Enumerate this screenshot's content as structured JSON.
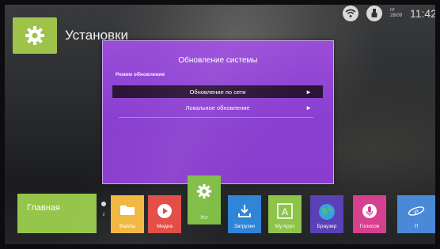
{
  "status_bar": {
    "wifi_icon": "wifi-icon",
    "usb_icon": "usb-icon",
    "weekday": "пт",
    "date": "28/09",
    "time": "11:42"
  },
  "header": {
    "icon": "gear-icon",
    "title": "Установки"
  },
  "dialog": {
    "title": "Обновление системы",
    "section_label": "Режим обновления",
    "options": [
      {
        "label": "Обновление по сети",
        "selected": true
      },
      {
        "label": "Локальное обновление",
        "selected": false
      }
    ]
  },
  "dock": {
    "home_label": "Главная",
    "page_number": "2",
    "apps": [
      {
        "label": "Файлы",
        "icon": "folder-icon",
        "color": "#f0b63b"
      },
      {
        "label": "Медиа",
        "icon": "play-icon",
        "color": "#e2473f"
      },
      {
        "label": "Уст",
        "icon": "gear-icon",
        "color": "#7fbd45"
      },
      {
        "label": "Загрузки",
        "icon": "download-icon",
        "color": "#2f86d6"
      },
      {
        "label": "My Apps",
        "icon": "apps-a-icon",
        "color": "#8fc44b"
      },
      {
        "label": "Браузер",
        "icon": "globe-icon",
        "color": "#5a41b8"
      },
      {
        "label": "Голосов",
        "icon": "microphone-icon",
        "color": "#d6408f"
      },
      {
        "label": "П",
        "icon": "ie-icon",
        "color": "#4a88d8"
      }
    ]
  },
  "colors": {
    "dialog_bg": "#8a3fd0",
    "selected_row": "#2c1638",
    "home_tile": "#95c54a"
  }
}
